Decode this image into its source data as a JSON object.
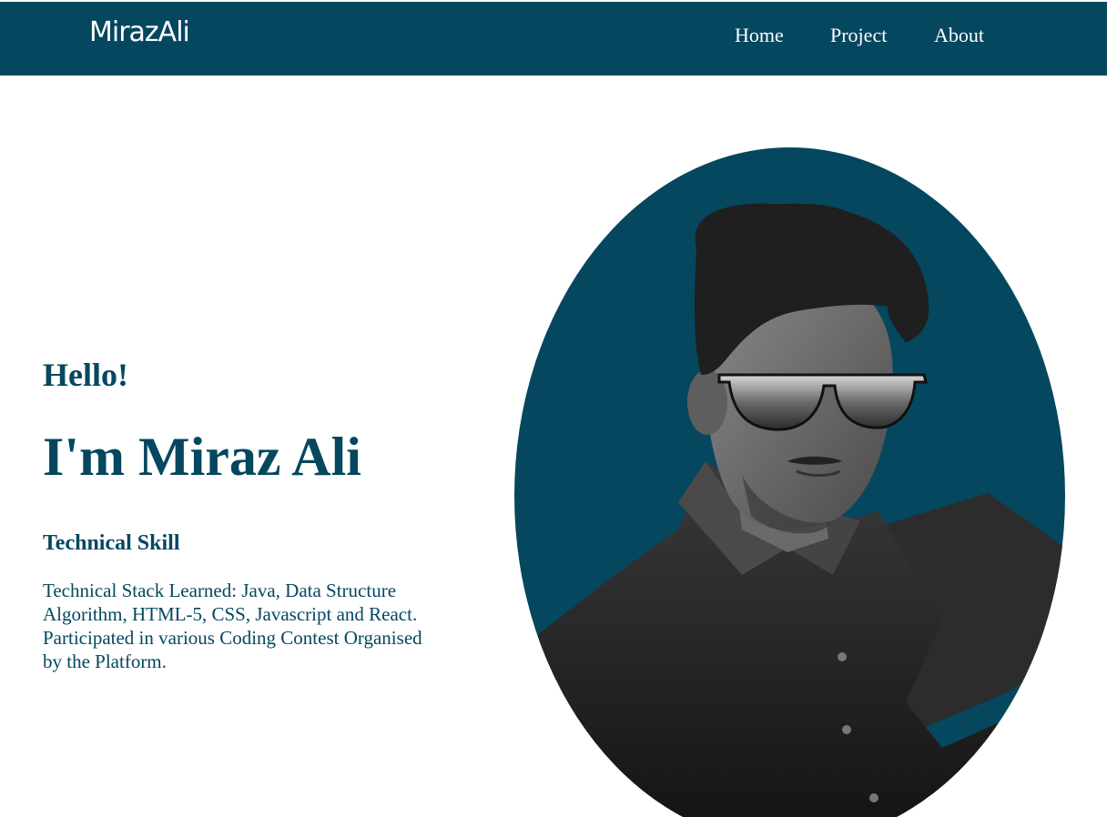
{
  "header": {
    "brand": "MirazAli",
    "nav": [
      "Home",
      "Project",
      "About"
    ]
  },
  "hero": {
    "greeting": "Hello!",
    "name": "I'm Miraz Ali",
    "skill_heading": "Technical Skill",
    "skill_description": "Technical Stack Learned: Java, Data Structure Algorithm, HTML-5, CSS, Javascript and React. Participated in various Coding Contest Organised by the Platform."
  },
  "colors": {
    "primary": "#05475f",
    "background": "#ffffff"
  }
}
